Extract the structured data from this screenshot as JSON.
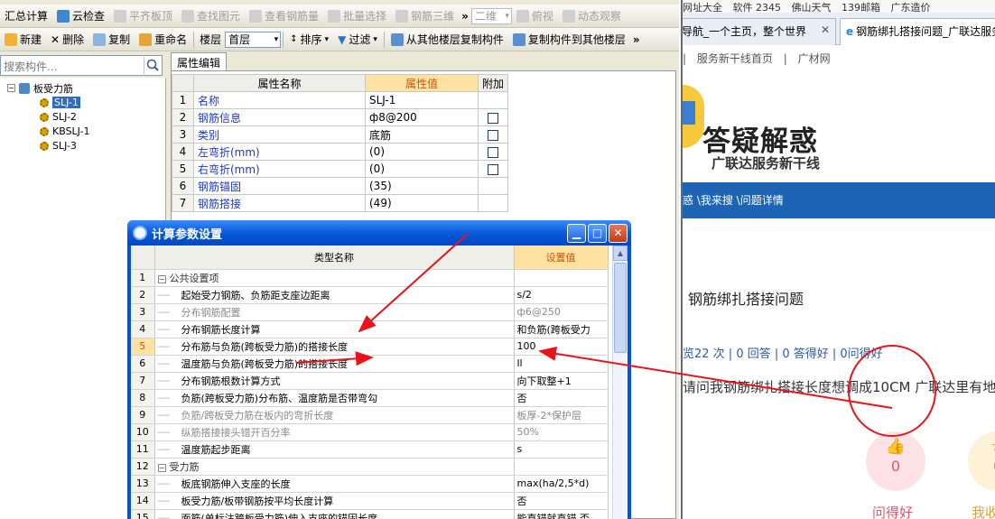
{
  "app": {
    "toolbar1": {
      "summary_calc": "汇总计算",
      "cloud_check": "云检查",
      "flush_slab_top": "平齐板顶",
      "find_element": "查找图元",
      "view_rebar_qty": "查看钢筋量",
      "batch_select": "批量选择",
      "rebar_3d": "钢筋三维",
      "view_2d": "二维",
      "top_view": "俯视",
      "dynamic_view": "动态观察"
    },
    "toolbar2": {
      "new": "新建",
      "delete": "删除",
      "copy": "复制",
      "rename": "重命名",
      "floor_label": "楼层",
      "floor_value": "首层",
      "sort": "排序",
      "filter": "过滤",
      "copy_from_floor": "从其他楼层复制构件",
      "copy_to_floor": "复制构件到其他楼层"
    },
    "search_placeholder": "搜索构件...",
    "tree": {
      "root": "板受力筋",
      "items": [
        "SLJ-1",
        "SLJ-2",
        "KBSLJ-1",
        "SLJ-3"
      ],
      "selected_index": 0
    },
    "properties": {
      "tab": "属性编辑",
      "headers": [
        "属性名称",
        "属性值",
        "附加"
      ],
      "rows": [
        {
          "n": "1",
          "name": "名称",
          "value": "SLJ-1",
          "check": false
        },
        {
          "n": "2",
          "name": "钢筋信息",
          "value": "ф8@200",
          "check": true
        },
        {
          "n": "3",
          "name": "类别",
          "value": "底筋",
          "check": true
        },
        {
          "n": "4",
          "name": "左弯折(mm)",
          "value": "(0)",
          "check": true
        },
        {
          "n": "5",
          "name": "右弯折(mm)",
          "value": "(0)",
          "check": true
        },
        {
          "n": "6",
          "name": "钢筋锚固",
          "value": "(35)",
          "check": false
        },
        {
          "n": "7",
          "name": "钢筋搭接",
          "value": "(49)",
          "check": false
        }
      ]
    }
  },
  "dialog": {
    "title": "计算参数设置",
    "headers": [
      "类型名称",
      "设置值"
    ],
    "rows": [
      {
        "n": "1",
        "name": "公共设置项",
        "value": "",
        "group": true
      },
      {
        "n": "2",
        "name": "起始受力钢筋、负筋距支座边距离",
        "value": "s/2"
      },
      {
        "n": "3",
        "name": "分布钢筋配置",
        "value": "ф6@250",
        "dim": true
      },
      {
        "n": "4",
        "name": "分布钢筋长度计算",
        "value": "和负筋(跨板受力"
      },
      {
        "n": "5",
        "name": "分布筋与负筋(跨板受力筋)的搭接长度",
        "value": "100",
        "current": true
      },
      {
        "n": "6",
        "name": "温度筋与负筋(跨板受力筋)的搭接长度",
        "value": "ll"
      },
      {
        "n": "7",
        "name": "分布钢筋根数计算方式",
        "value": "向下取整+1"
      },
      {
        "n": "8",
        "name": "负筋(跨板受力筋)分布筋、温度筋是否带弯勾",
        "value": "否"
      },
      {
        "n": "9",
        "name": "负筋/跨板受力筋在板内的弯折长度",
        "value": "板厚-2*保护层",
        "dim": true
      },
      {
        "n": "10",
        "name": "纵筋搭接接头错开百分率",
        "value": "50%",
        "dim": true
      },
      {
        "n": "11",
        "name": "温度筋起步距离",
        "value": "s"
      },
      {
        "n": "12",
        "name": "受力筋",
        "value": "",
        "group": true
      },
      {
        "n": "13",
        "name": "板底钢筋伸入支座的长度",
        "value": "max(ha/2,5*d)"
      },
      {
        "n": "14",
        "name": "板受力筋/板带钢筋按平均长度计算",
        "value": "否"
      },
      {
        "n": "15",
        "name": "面筋(单标注跨板受力筋)伸入支座的锚固长度",
        "value": "能直锚就直锚,否"
      }
    ]
  },
  "browser": {
    "bookmarks": [
      "网址大全",
      "软件 2345",
      "佛山天气",
      "139邮箱",
      "广东造价"
    ],
    "tab1": "导航_一个主页，整个世界",
    "tab2": "钢筋绑扎搭接问题_广联达服务",
    "subnav": [
      "服务新干线首页",
      "广材网"
    ],
    "brand_title": "答疑解惑",
    "brand_sub": "广联达服务新干线",
    "breadcrumb": "惑 \\我来搜 \\问题详情",
    "question_title": "钢筋绑扎搭接问题",
    "stats": "览22 次 | 0 回答 | 0 答得好 | 0问得好",
    "body": "请问我钢筋绑扎搭接长度想调成10CM 广联达里有地",
    "like_count": "0",
    "like_label": "问得好",
    "second_count": "0",
    "second_label": "我收"
  },
  "colors": {
    "annotation_red": "#e8141c",
    "xp_blue": "#0054e3",
    "highlight_orange": "#fde2a4",
    "banner_blue": "#1e64b4"
  }
}
